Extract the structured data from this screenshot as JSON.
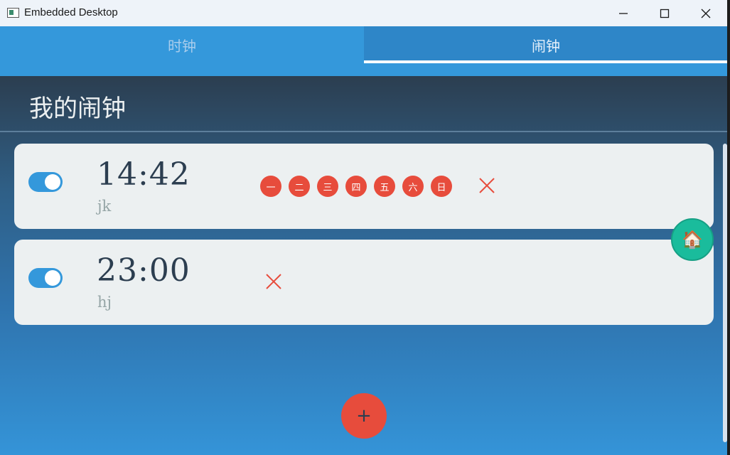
{
  "window": {
    "title": "Embedded Desktop"
  },
  "tabs": [
    {
      "label": "时钟",
      "active": false
    },
    {
      "label": "闹钟",
      "active": true
    }
  ],
  "page": {
    "title": "我的闹钟"
  },
  "alarms": [
    {
      "enabled": true,
      "time": "14:42",
      "label": "jk",
      "days": [
        "一",
        "二",
        "三",
        "四",
        "五",
        "六",
        "日"
      ]
    },
    {
      "enabled": true,
      "time": "23:00",
      "label": "hj",
      "days": []
    }
  ],
  "buttons": {
    "add": "+",
    "home_icon": "house-emoji"
  },
  "colors": {
    "accent": "#3498db",
    "day_chip": "#e74c3c",
    "delete": "#e74c3c",
    "add_button": "#e74c3c",
    "home_button": "#1abc9c",
    "card": "#ecf0f1",
    "header": "#2c3e50"
  }
}
